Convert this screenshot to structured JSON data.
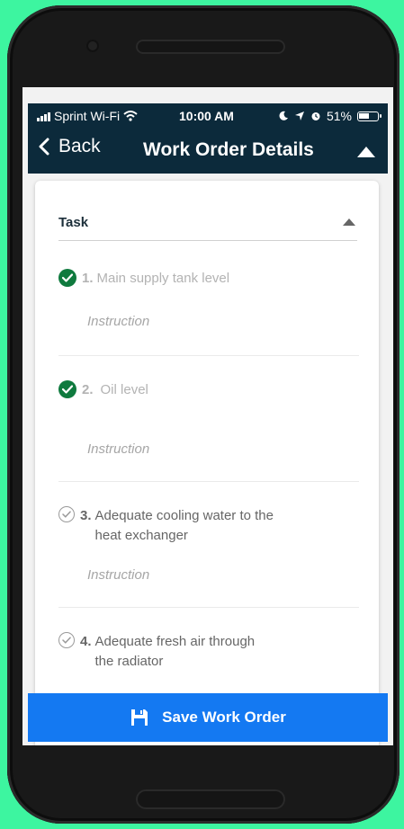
{
  "status_bar": {
    "carrier": "Sprint Wi-Fi",
    "time": "10:00 AM",
    "battery": "51%"
  },
  "nav": {
    "back_label": "Back",
    "title": "Work Order Details"
  },
  "task_section": {
    "label": "Task"
  },
  "tasks": [
    {
      "number": "1.",
      "text": "Main supply tank level",
      "instruction": "Instruction",
      "state": "done"
    },
    {
      "number": "2.",
      "text": "Oil level",
      "instruction": "Instruction",
      "state": "done"
    },
    {
      "number": "3.",
      "text_line1": "Adequate cooling water to the",
      "text_line2": "heat exchanger",
      "instruction": "Instruction",
      "state": "pending"
    },
    {
      "number": "4.",
      "text_line1": "Adequate fresh air through",
      "text_line2": "the radiator",
      "state": "pending"
    }
  ],
  "save_button": {
    "label": "Save Work Order"
  },
  "colors": {
    "background": "#3df5a0",
    "header": "#0c2a3b",
    "accent": "#1479f2",
    "check": "#0f7a3e"
  }
}
